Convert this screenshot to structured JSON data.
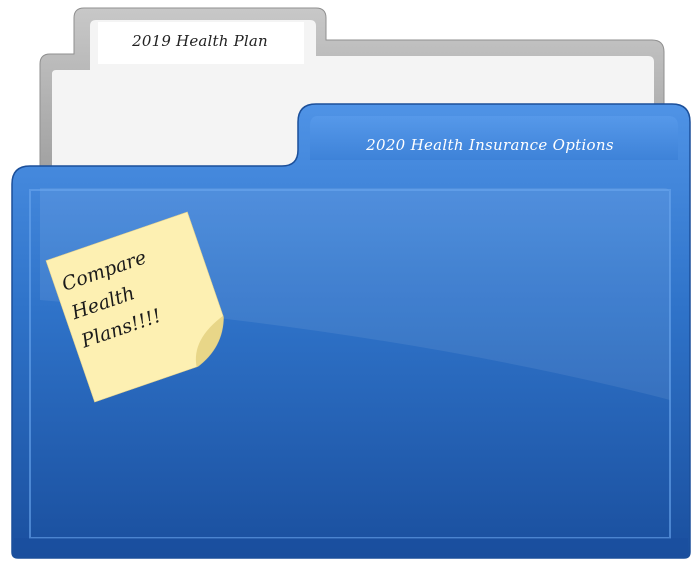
{
  "folders": {
    "back_tab_label": "2019 Health Plan",
    "front_tab_label": "2020 Health Insurance Options"
  },
  "sticky_note": {
    "lines": [
      "Compare",
      "Health",
      "Plans!!!!"
    ]
  },
  "colors": {
    "folder_blue": "#2f73c9",
    "folder_blue_dark": "#1d56a8",
    "back_folder_border": "#a9a9a9",
    "sticky_yellow": "#fdf0b2"
  }
}
